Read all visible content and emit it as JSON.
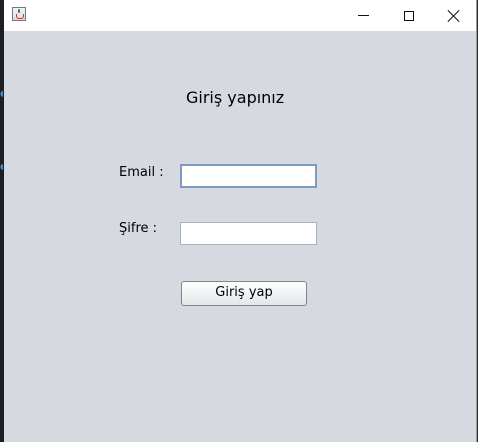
{
  "window": {
    "icon": "java-cup-icon",
    "controls": {
      "minimize_icon": "minimize-icon",
      "maximize_icon": "maximize-icon",
      "close_icon": "close-icon"
    }
  },
  "form": {
    "heading": "Giriş yapınız",
    "email_label": "Email :",
    "email_value": "",
    "password_label": "Şifre :",
    "password_value": "",
    "submit_label": "Giriş yap"
  },
  "colors": {
    "window_background": "#d6d9df",
    "titlebar_background": "#ffffff",
    "focus_border": "#7a9cc4"
  }
}
